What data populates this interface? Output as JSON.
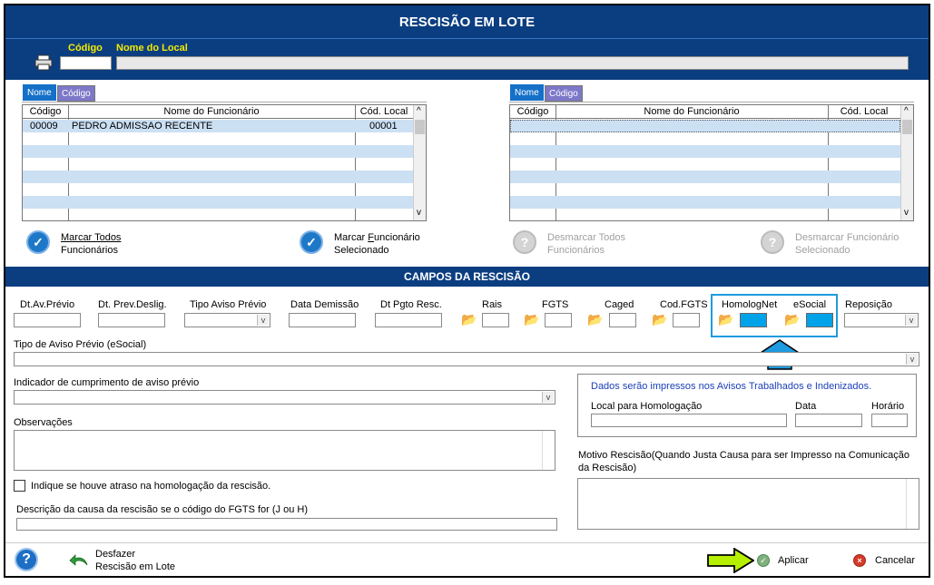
{
  "window": {
    "title": "RESCISÃO EM LOTE"
  },
  "header": {
    "codigo_label": "Código",
    "nome_local_label": "Nome do Local",
    "codigo_value": "",
    "nome_local_value": "",
    "printer_icon": "printer-icon"
  },
  "left_grid": {
    "tabs": [
      "Nome",
      "Código"
    ],
    "columns": [
      "Código",
      "Nome do Funcionário",
      "Cód. Local"
    ],
    "rows": [
      {
        "codigo": "00009",
        "nome": "PEDRO ADMISSAO RECENTE",
        "cod_local": "00001"
      }
    ]
  },
  "right_grid": {
    "tabs": [
      "Nome",
      "Código"
    ],
    "columns": [
      "Código",
      "Nome do Funcionário",
      "Cód. Local"
    ],
    "rows": []
  },
  "actions": {
    "marcar_todos": "Marcar Todos",
    "marcar_todos_2": "Funcionários",
    "marcar_func_pre": "Marcar ",
    "marcar_func_u": "F",
    "marcar_func_post": "uncionário",
    "marcar_func_2": "Selecionado",
    "desmarcar_todos": "Desmarcar Todos",
    "desmarcar_todos_2": "Funcionários",
    "desmarcar_func": "Desmarcar Funcionário",
    "desmarcar_func_2": "Selecionado"
  },
  "section": {
    "title": "CAMPOS DA RESCISÃO"
  },
  "fields": {
    "dt_av_previo": "Dt.Av.Prévio",
    "dt_prev_deslig": "Dt. Prev.Deslig.",
    "tipo_aviso_previo": "Tipo Aviso Prévio",
    "data_demissao": "Data Demissão",
    "dt_pgto_resc": "Dt Pgto Resc.",
    "rais": "Rais",
    "fgts": "FGTS",
    "caged": "Caged",
    "cod_fgts": "Cod.FGTS",
    "homolognet": "HomologNet",
    "esocial": "eSocial",
    "reposicao": "Reposição",
    "tipo_aviso_esocial": "Tipo de Aviso Prévio (eSocial)",
    "indicador_cumprimento": "Indicador de cumprimento de aviso prévio",
    "observacoes": "Observações",
    "atraso_homologacao": "Indique se houve atraso na homologação da rescisão.",
    "descricao_causa": "Descrição da causa da rescisão se o código do FGTS for (J ou H)",
    "dados_impressos": "Dados serão impressos nos Avisos Trabalhados e Indenizados.",
    "local_homologacao": "Local para Homologação",
    "data": "Data",
    "horario": "Horário",
    "motivo_rescisao": "Motivo Rescisão(Quando Justa Causa para ser Impresso na Comunicação da Rescisão)"
  },
  "footer": {
    "desfazer": "Desfazer",
    "desfazer_2": "Rescisão em Lote",
    "aplicar": "Aplicar",
    "cancelar": "Cancelar"
  },
  "colors": {
    "title_bg": "#0b3e80",
    "label_yellow": "#f4ea00",
    "highlight_blue": "#1e9be0",
    "annotation_green": "#b6f000"
  }
}
